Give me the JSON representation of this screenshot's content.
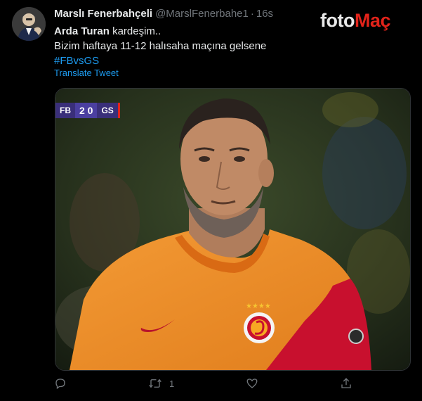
{
  "tweet": {
    "author_name": "Marslı Fenerbahçeli",
    "handle": "@MarslFenerbahe1",
    "separator": "·",
    "time": "16s",
    "text_bold": "Arda Turan",
    "text_line1_rest": " kardeşim..",
    "text_line2": "Bizim haftaya 11-12 halısaha maçına gelsene",
    "hashtag": "#FBvsGS",
    "translate_label": "Translate Tweet"
  },
  "watermark": {
    "part1": "foto",
    "part2": "Maç"
  },
  "scoreboard": {
    "home": "FB",
    "score": "2 0",
    "away": "GS"
  },
  "actions": {
    "reply_count": "",
    "retweet_count": "1",
    "like_count": ""
  },
  "colors": {
    "background": "#000000",
    "link": "#1d9bf0",
    "muted": "#71767b",
    "jersey": "#f08a24",
    "jersey_stripe": "#c8102e"
  },
  "icons": [
    "reply-icon",
    "retweet-icon",
    "like-icon",
    "share-icon"
  ]
}
